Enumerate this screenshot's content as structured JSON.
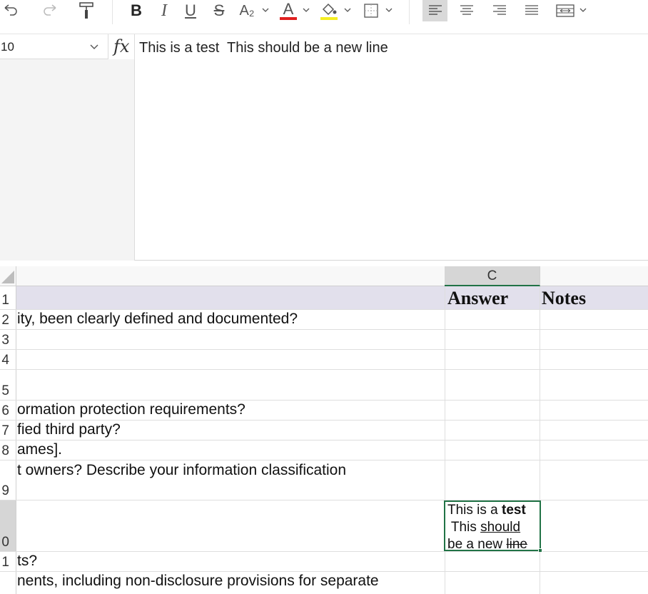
{
  "toolbar": {
    "buttons": [
      {
        "name": "undo-icon"
      },
      {
        "name": "redo-icon"
      },
      {
        "name": "format-painter-icon"
      },
      {
        "name": "bold-icon",
        "label": "B"
      },
      {
        "name": "italic-icon",
        "label": "I"
      },
      {
        "name": "underline-icon",
        "label": "U"
      },
      {
        "name": "strikethrough-icon",
        "label": "S"
      },
      {
        "name": "subscript-icon",
        "label": "A₂"
      },
      {
        "name": "font-color-icon",
        "label": "A"
      },
      {
        "name": "fill-color-icon"
      },
      {
        "name": "borders-icon"
      },
      {
        "name": "align-left-icon"
      },
      {
        "name": "align-center-icon"
      },
      {
        "name": "align-right-icon"
      },
      {
        "name": "justify-icon"
      },
      {
        "name": "merge-cells-icon"
      }
    ],
    "font_color": "#e02020",
    "fill_color": "#f5ee22",
    "active_color": "#d9d9d9"
  },
  "formula_bar": {
    "name_box": "10",
    "fx_label": "fx",
    "formula": "This is a test  This should be a new line"
  },
  "grid": {
    "columns": [
      {
        "label": "C",
        "selected": true
      }
    ],
    "header_row": {
      "num": "1",
      "answer": "Answer",
      "notes": "Notes"
    },
    "rows": [
      {
        "num": "2",
        "a": "ity, been clearly defined and documented?"
      },
      {
        "num": "3",
        "a": ""
      },
      {
        "num": "4",
        "a": ""
      },
      {
        "num": "5",
        "a": ""
      },
      {
        "num": "6",
        "a": "ormation protection requirements?"
      },
      {
        "num": "7",
        "a": "fied third party?"
      },
      {
        "num": "8",
        "a": "ames]."
      },
      {
        "num": "9",
        "a": "t owners? Describe your information classification"
      },
      {
        "num": "0",
        "a": ""
      },
      {
        "num": "1",
        "a": "ts?"
      },
      {
        "num": "",
        "a": "nents, including non-disclosure provisions for separate"
      }
    ],
    "active_cell": {
      "line1_plain": "This is a ",
      "line1_bold": "test",
      "line2_plain": " This ",
      "line2_underline": "should",
      "line3_plain": "be a new ",
      "line3_strike": "line"
    },
    "selection_color": "#217346"
  }
}
